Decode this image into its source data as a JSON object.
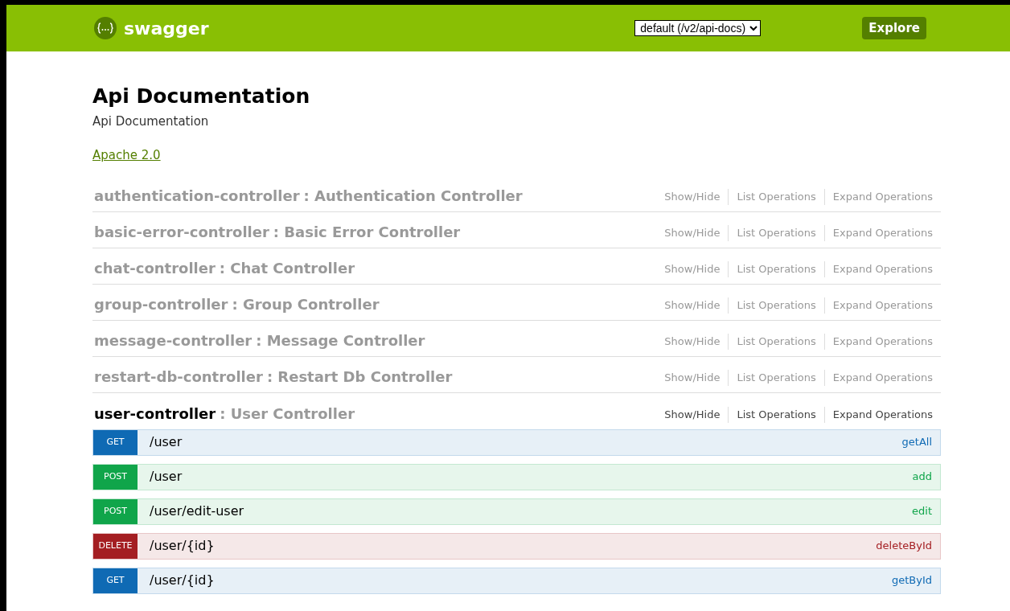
{
  "header": {
    "logo": "swagger",
    "spec_select": {
      "value": "default (/v2/api-docs)"
    },
    "explore_button": "Explore"
  },
  "info": {
    "title": "Api Documentation",
    "description": "Api Documentation",
    "license_link": "Apache 2.0"
  },
  "controllers": [
    {
      "name": "authentication-controller",
      "description": ": Authentication Controller",
      "expanded": false,
      "actions": [
        "Show/Hide",
        "List Operations",
        "Expand Operations"
      ]
    },
    {
      "name": "basic-error-controller",
      "description": ": Basic Error Controller",
      "expanded": false,
      "actions": [
        "Show/Hide",
        "List Operations",
        "Expand Operations"
      ]
    },
    {
      "name": "chat-controller",
      "description": ": Chat Controller",
      "expanded": false,
      "actions": [
        "Show/Hide",
        "List Operations",
        "Expand Operations"
      ]
    },
    {
      "name": "group-controller",
      "description": ": Group Controller",
      "expanded": false,
      "actions": [
        "Show/Hide",
        "List Operations",
        "Expand Operations"
      ]
    },
    {
      "name": "message-controller",
      "description": ": Message Controller",
      "expanded": false,
      "actions": [
        "Show/Hide",
        "List Operations",
        "Expand Operations"
      ]
    },
    {
      "name": "restart-db-controller",
      "description": ": Restart Db Controller",
      "expanded": false,
      "actions": [
        "Show/Hide",
        "List Operations",
        "Expand Operations"
      ]
    },
    {
      "name": "user-controller",
      "description": ": User Controller",
      "expanded": true,
      "actions": [
        "Show/Hide",
        "List Operations",
        "Expand Operations"
      ],
      "operations": [
        {
          "kind": "get",
          "method": "GET",
          "path": "/user",
          "summary": "getAll"
        },
        {
          "kind": "post",
          "method": "POST",
          "path": "/user",
          "summary": "add"
        },
        {
          "kind": "post",
          "method": "POST",
          "path": "/user/edit-user",
          "summary": "edit"
        },
        {
          "kind": "delete",
          "method": "DELETE",
          "path": "/user/{id}",
          "summary": "deleteById"
        },
        {
          "kind": "get",
          "method": "GET",
          "path": "/user/{id}",
          "summary": "getById"
        }
      ]
    }
  ]
}
